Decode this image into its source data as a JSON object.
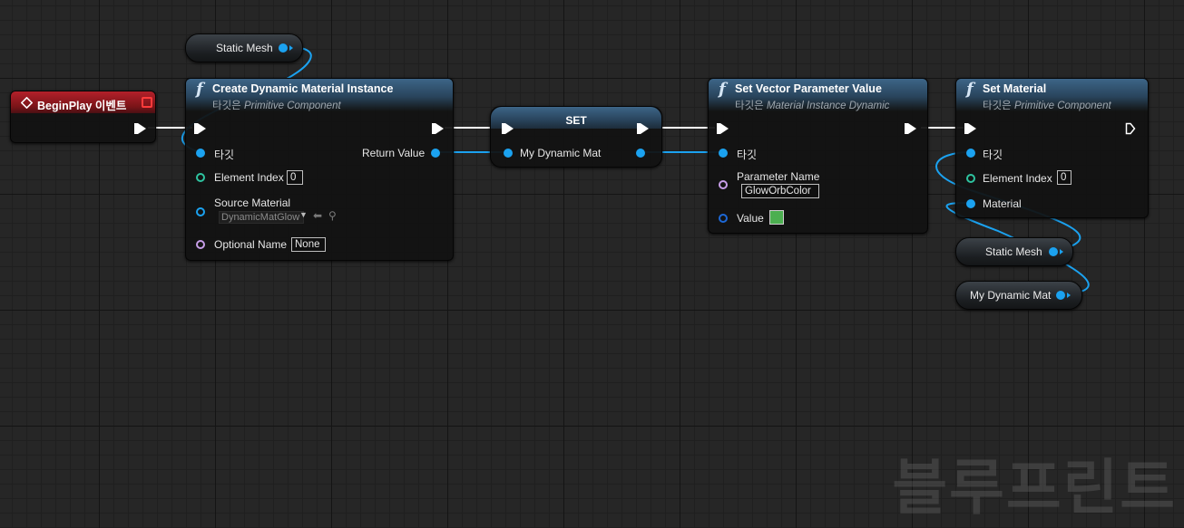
{
  "editor": {
    "watermark": "블루프린트"
  },
  "nodes": {
    "static_mesh_var_top": {
      "label": "Static Mesh"
    },
    "begin_play": {
      "title": "BeginPlay 이벤트"
    },
    "create_dmi": {
      "title": "Create Dynamic Material Instance",
      "subtitle_prefix": "타깃은 ",
      "subtitle_target": "Primitive Component",
      "pin_target": "타깃",
      "pin_return": "Return Value",
      "pin_element_index": "Element Index",
      "element_index_value": "0",
      "pin_source_material": "Source Material",
      "source_material_value": "DynamicMatGlow",
      "pin_optional_name": "Optional Name",
      "optional_name_value": "None"
    },
    "set_var": {
      "title": "SET",
      "pin_var": "My Dynamic Mat"
    },
    "set_vector_param": {
      "title": "Set Vector Parameter Value",
      "subtitle_prefix": "타깃은 ",
      "subtitle_target": "Material Instance Dynamic",
      "pin_target": "타깃",
      "pin_param_name": "Parameter Name",
      "param_name_value": "GlowOrbColor",
      "pin_value": "Value",
      "value_color": "#4caf50"
    },
    "set_material": {
      "title": "Set Material",
      "subtitle_prefix": "타깃은 ",
      "subtitle_target": "Primitive Component",
      "pin_target": "타깃",
      "pin_element_index": "Element Index",
      "element_index_value": "0",
      "pin_material": "Material"
    },
    "static_mesh_var_bottom": {
      "label": "Static Mesh"
    },
    "my_dynamic_mat_var": {
      "label": "My Dynamic Mat"
    }
  },
  "colors": {
    "object_pin": "#1ba2f0",
    "exec_wire": "#ffffff",
    "event_header": "#b3202a",
    "function_header": "#3d6587"
  },
  "icons": {
    "function": "f",
    "event": "diamond-icon",
    "browse": "arrow-left-icon",
    "search": "magnifier-icon"
  }
}
